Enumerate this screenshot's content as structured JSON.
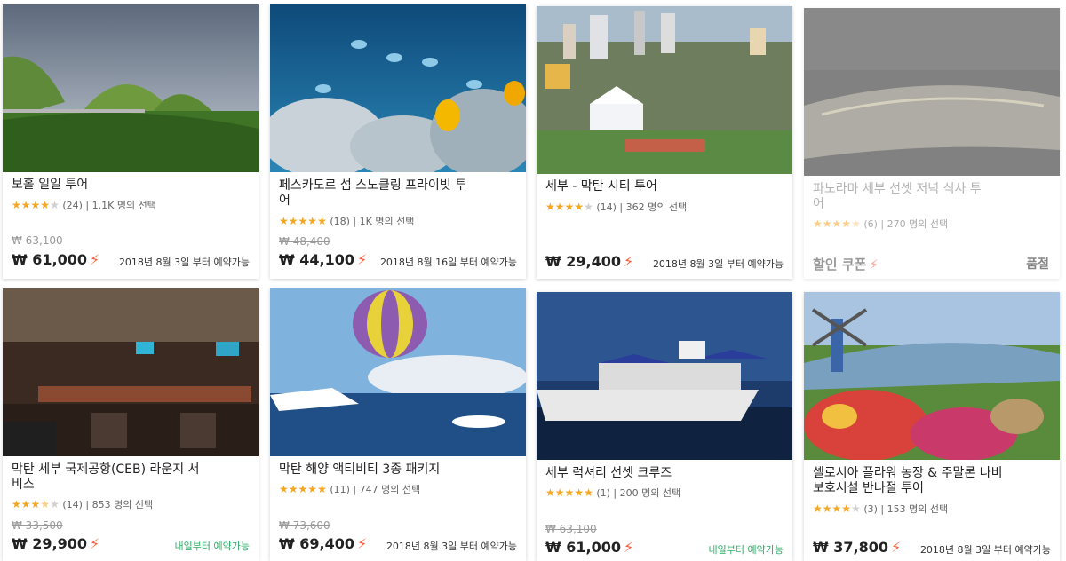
{
  "cards": [
    {
      "title": "보홀 일일 투어",
      "rating_text": "(24)",
      "count_text": "1.1K 명의 선택",
      "stars": 4,
      "old_price": "₩ 63,100",
      "price": "₩ 61,000",
      "bolt": "⚡",
      "avail": "2018년 8월 3일 부터 예약가능"
    },
    {
      "title": "페스카도르 섬 스노클링 프라이빗 투어",
      "rating_text": "(18)",
      "count_text": "1K 명의 선택",
      "stars": 5,
      "old_price": "₩ 48,400",
      "price": "₩ 44,100",
      "bolt": "⚡",
      "avail": "2018년 8월 16일 부터 예약가능"
    },
    {
      "title": "세부 - 막탄 시티 투어",
      "rating_text": "(14)",
      "count_text": "362 명의 선택",
      "stars": 4,
      "old_price": "",
      "price": "₩ 29,400",
      "bolt": "⚡",
      "avail": "2018년 8월 3일 부터 예약가능"
    },
    {
      "title": "파노라마 세부 선셋 저녁 식사 투어",
      "rating_text": "(6)",
      "count_text": "270 명의 선택",
      "stars": 4.5,
      "coupon": "할인 쿠폰",
      "bolt": "⚡",
      "soldout": "품절"
    },
    {
      "title": "막탄 세부 국제공항(CEB) 라운지 서비스",
      "rating_text": "(14)",
      "count_text": "853 명의 선택",
      "stars": 3.5,
      "old_price": "₩ 33,500",
      "price": "₩ 29,900",
      "bolt": "⚡",
      "avail": "내일부터 예약가능"
    },
    {
      "title": "막탄 해양 액티비티 3종 패키지",
      "rating_text": "(11)",
      "count_text": "747 명의 선택",
      "stars": 5,
      "old_price": "₩ 73,600",
      "price": "₩ 69,400",
      "bolt": "⚡",
      "avail": "2018년 8월 3일 부터 예약가능"
    },
    {
      "title": "세부 럭셔리 선셋 크루즈",
      "rating_text": "(1)",
      "count_text": "200 명의 선택",
      "stars": 5,
      "old_price": "₩ 63,100",
      "price": "₩ 61,000",
      "bolt": "⚡",
      "avail": "내일부터 예약가능"
    },
    {
      "title": "셀로시아 플라워 농장 & 주말론 나비 보호시설 반나절 투어",
      "rating_text": "(3)",
      "count_text": "153 명의 선택",
      "stars": 4,
      "old_price": "",
      "price": "₩ 37,800",
      "bolt": "⚡",
      "avail": "2018년 8월 3일 부터 예약가능"
    }
  ],
  "colors": {
    "star": "#f5a623",
    "bolt": "#ff5a36",
    "green": "#2eaa66"
  }
}
